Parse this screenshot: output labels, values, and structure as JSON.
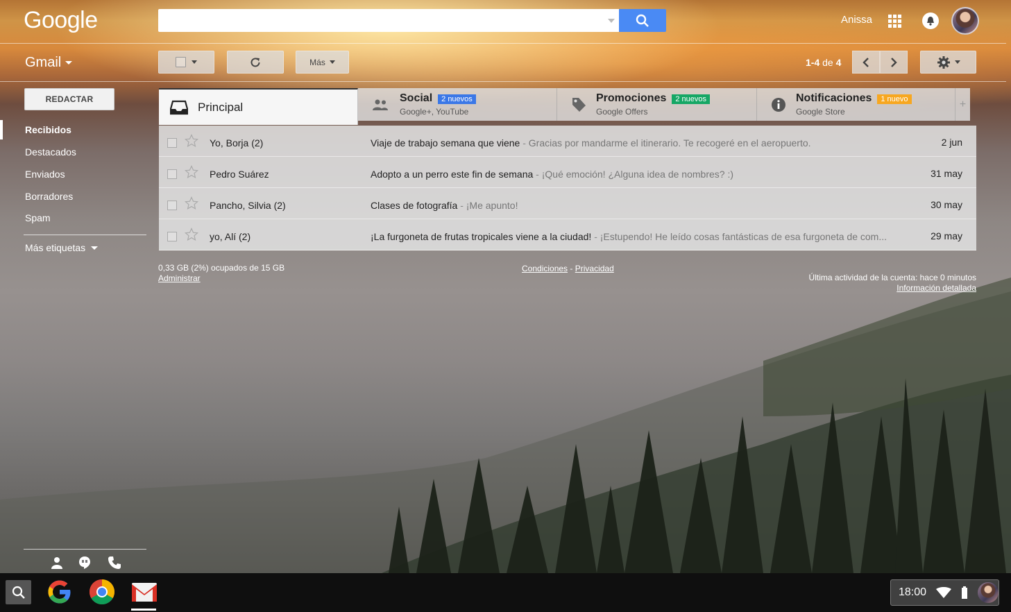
{
  "header": {
    "logo_text": "Google",
    "search_placeholder": "",
    "user_name": "Anissa"
  },
  "toolbar": {
    "app_label": "Gmail",
    "more_label": "Más",
    "pager_range": "1-4",
    "pager_of": "de",
    "pager_total": "4"
  },
  "sidebar": {
    "compose_label": "REDACTAR",
    "items": [
      {
        "label": "Recibidos",
        "active": true
      },
      {
        "label": "Destacados"
      },
      {
        "label": "Enviados"
      },
      {
        "label": "Borradores"
      },
      {
        "label": "Spam"
      }
    ],
    "more_labels": "Más etiquetas"
  },
  "tabs": [
    {
      "title": "Principal",
      "subtitle": "",
      "badge": "",
      "icon": "inbox-icon"
    },
    {
      "title": "Social",
      "subtitle": "Google+, YouTube",
      "badge": "2 nuevos",
      "badge_color": "#3b78e7",
      "icon": "people-icon"
    },
    {
      "title": "Promociones",
      "subtitle": "Google Offers",
      "badge": "2 nuevos",
      "badge_color": "#16a765",
      "icon": "tag-icon"
    },
    {
      "title": "Notificaciones",
      "subtitle": "Google Store",
      "badge": "1 nuevo",
      "badge_color": "#f7a720",
      "icon": "info-icon"
    }
  ],
  "emails": [
    {
      "sender": "Yo, Borja (2)",
      "subject": "Viaje de trabajo semana que viene",
      "snippet": "Gracias por mandarme el itinerario. Te recogeré en el aeropuerto.",
      "date": "2 jun"
    },
    {
      "sender": "Pedro Suárez",
      "subject": "Adopto a un perro este fin de semana",
      "snippet": "¡Qué emoción! ¿Alguna idea de nombres? :)",
      "date": "31 may"
    },
    {
      "sender": "Pancho, Silvia (2)",
      "subject": "Clases de fotografía",
      "snippet": "¡Me apunto!",
      "date": "30 may"
    },
    {
      "sender": "yo, Alí (2)",
      "subject": "¡La furgoneta de frutas tropicales viene a la ciudad!",
      "snippet": "¡Estupendo! He leído cosas fantásticas de esa furgoneta de com...",
      "date": "29 may"
    }
  ],
  "snippet_separator": "-",
  "footer": {
    "storage": "0,33 GB (2%) ocupados de 15 GB",
    "manage": "Administrar",
    "terms": "Condiciones",
    "dash": "-",
    "privacy": "Privacidad",
    "activity": "Última actividad de la cuenta: hace 0 minutos",
    "details": "Información detallada"
  },
  "shelf": {
    "time": "18:00",
    "apps": [
      "google-search-app",
      "chrome-app",
      "gmail-app"
    ]
  },
  "colors": {
    "search_button": "#4a8af4",
    "badge_social": "#3b78e7",
    "badge_promos": "#16a765",
    "badge_notif": "#f7a720"
  }
}
